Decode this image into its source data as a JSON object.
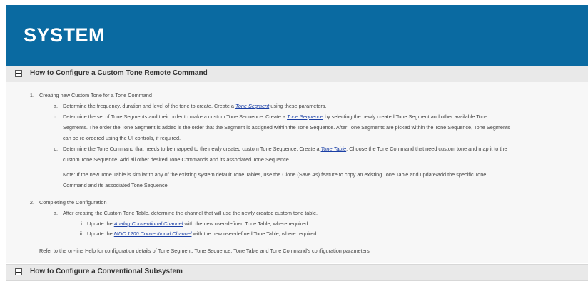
{
  "header": {
    "title": "SYSTEM"
  },
  "sections": [
    {
      "title": "How to Configure a Custom Tone Remote Command",
      "state": "expanded"
    },
    {
      "title": "How to Configure a Conventional Subsystem",
      "state": "collapsed"
    }
  ],
  "content": {
    "item1": {
      "num": "1.",
      "text": "Creating new Custom Tone for a Tone Command",
      "a": {
        "label": "a.",
        "pre": "Determine the frequency, duration and level of the tone to create. Create a ",
        "link": "Tone Segment",
        "post": " using these parameters."
      },
      "b": {
        "label": "b.",
        "l1_pre": "Determine the set of Tone Segments and their order to make a custom Tone Sequence. Create a ",
        "l1_link": "Tone Sequence",
        "l1_post": " by selecting the newly created Tone Segment and other available Tone",
        "l2": "Segments. The order the Tone Segment is added is the order that the Segment is assigned within the Tone Sequence. After Tone Segments are picked within the Tone Sequence, Tone Segments",
        "l3": "can be re-ordered using the UI controls, if required."
      },
      "c": {
        "label": "c.",
        "l1_pre": "Determine the Tone Command that needs to be mapped to the newly created custom Tone Sequence. Create a ",
        "l1_link": "Tone Table",
        "l1_post": ". Choose the Tone Command that need custom tone and map it to the",
        "l2": "custom Tone Sequence. Add all other desired Tone Commands and its associated Tone Sequence."
      },
      "note": {
        "l1": "Note: If the new Tone Table is similar to any of the existing system default Tone Tables, use the Clone (Save As) feature to copy an existing Tone Table and update/add the specific Tone",
        "l2": "Command and its associated Tone Sequence"
      }
    },
    "item2": {
      "num": "2.",
      "text": "Completing the Configuration",
      "a": {
        "label": "a.",
        "text": "After creating the Custom Tone Table, determine the channel that will use the newly created custom tone table."
      },
      "i": {
        "label": "i.",
        "pre": "Update the ",
        "link": "Analog Conventional Channel",
        "post": " with the new user-defined Tone Table, where required."
      },
      "ii": {
        "label": "ii.",
        "pre": "Update the ",
        "link": "MDC 1200 Conventional Channel",
        "post": " with the new user-defined Tone Table, where required."
      }
    },
    "refer": "Refer to the on-line Help for configuration details of Tone Segment, Tone Sequence, Tone Table and Tone Command's configuration parameters"
  }
}
